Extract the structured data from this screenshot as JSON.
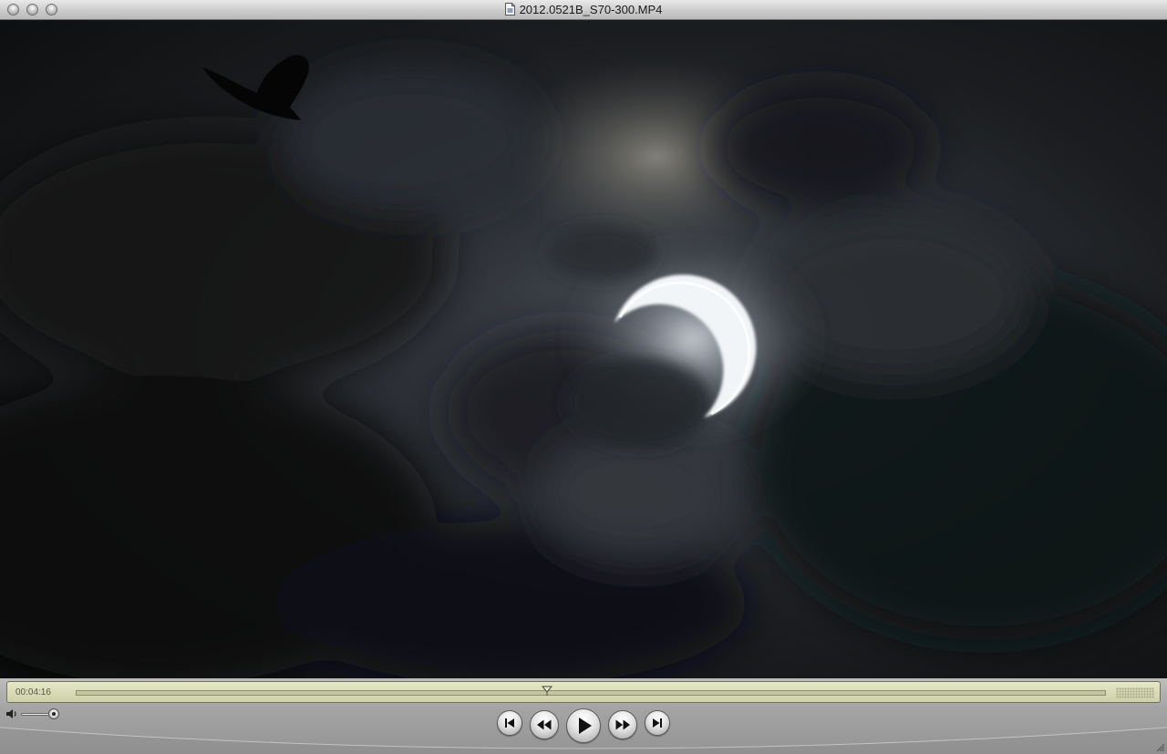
{
  "window": {
    "title": "2012.0521B_S70-300.MP4",
    "title_icon": "document-icon"
  },
  "window_controls": {
    "close_icon": "close-icon",
    "minimize_icon": "minimize-icon",
    "zoom_icon": "zoom-icon"
  },
  "video": {
    "content": "annular-solar-eclipse-with-bird"
  },
  "controller": {
    "current_time": "00:04:16",
    "playhead_position": 0.475,
    "volume_level": 0.85,
    "buttons": {
      "go_to_start_icon": "skip-to-start-icon",
      "rewind_icon": "rewind-icon",
      "play_icon": "play-icon",
      "fast_forward_icon": "fast-forward-icon",
      "go_to_end_icon": "skip-to-end-icon"
    },
    "volume_icon": "speaker-icon"
  },
  "colors": {
    "lcd_background": "#d9dcb6",
    "lcd_text": "#555848",
    "controller_background": "#a8a8a8"
  }
}
